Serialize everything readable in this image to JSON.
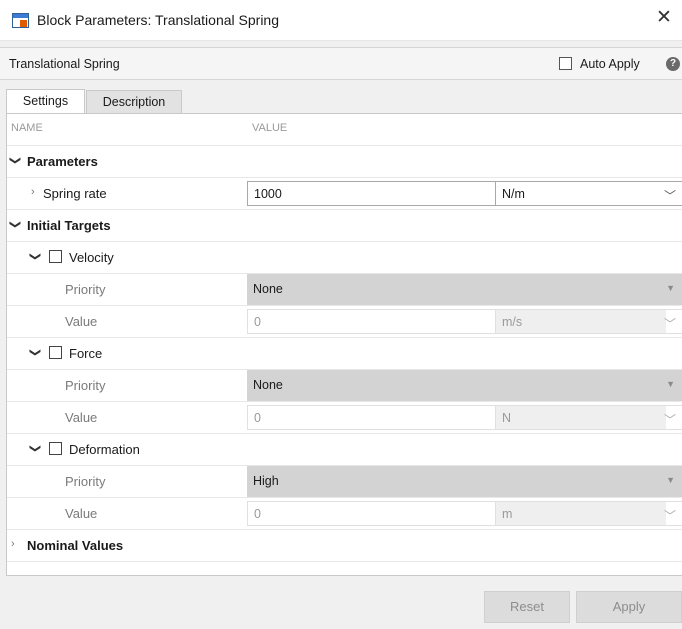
{
  "window": {
    "title": "Block Parameters: Translational Spring"
  },
  "header": {
    "block_name": "Translational Spring",
    "auto_apply_label": "Auto Apply",
    "help_glyph": "?"
  },
  "tabs": [
    {
      "label": "Settings",
      "active": true
    },
    {
      "label": "Description",
      "active": false
    }
  ],
  "columns": {
    "name": "NAME",
    "value": "VALUE"
  },
  "parameters": {
    "label": "Parameters",
    "spring_rate": {
      "label": "Spring rate",
      "value": "1000",
      "unit": "N/m"
    }
  },
  "initial_targets": {
    "label": "Initial Targets",
    "velocity": {
      "label": "Velocity",
      "checked": false,
      "priority_label": "Priority",
      "priority": "None",
      "value_label": "Value",
      "value": "0",
      "unit": "m/s"
    },
    "force": {
      "label": "Force",
      "checked": false,
      "priority_label": "Priority",
      "priority": "None",
      "value_label": "Value",
      "value": "0",
      "unit": "N"
    },
    "deformation": {
      "label": "Deformation",
      "checked": false,
      "priority_label": "Priority",
      "priority": "High",
      "value_label": "Value",
      "value": "0",
      "unit": "m"
    }
  },
  "nominal_values": {
    "label": "Nominal Values",
    "expanded": false
  },
  "footer": {
    "reset_label": "Reset",
    "apply_label": "Apply"
  },
  "icons": {
    "app": "simulink-block-icon",
    "close": "close-icon",
    "help": "help-icon",
    "expand": "chevron-down-icon",
    "collapse": "chevron-right-icon",
    "dropdown": "chevron-down-icon"
  }
}
